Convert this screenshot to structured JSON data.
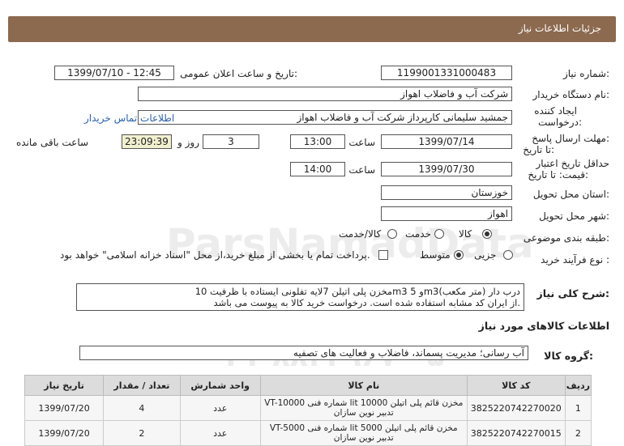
{
  "header": {
    "title": "جزئیات اطلاعات نیاز"
  },
  "fields": {
    "need_number_label": "شماره نیاز:",
    "need_number": "1199001331000483",
    "announce_label": "تاریخ و ساعت اعلان عمومی:",
    "announce_value": "1399/07/10 - 12:45",
    "buyer_label": "نام دستگاه خریدار:",
    "buyer_value": "شرکت آب و فاضلاب اهواز",
    "creator_label_1": "ایجاد کننده",
    "creator_label_2": "درخواست:",
    "creator_value": "جمشید سلیمانی کارپرداز شرکت آب و فاضلاب اهواز",
    "contact_link": "اطلاعات تماس خریدار",
    "deadline_label_1": "مهلت ارسال پاسخ:",
    "deadline_label_2": "تا تاریخ:",
    "deadline_date": "1399/07/14",
    "time_label": "ساعت",
    "deadline_time": "13:00",
    "days_value": "3",
    "days_label": "روز و",
    "remaining_time": "23:09:39",
    "remaining_label": "ساعت باقی مانده",
    "validity_label_1": "حداقل تاریخ اعتبار",
    "validity_label_2": "قیمت: تا تاریخ:",
    "validity_date": "1399/07/30",
    "validity_time": "14:00",
    "province_label": "استان محل تحویل:",
    "province_value": "خوزستان",
    "city_label": "شهر محل تحویل:",
    "city_value": "اهواز",
    "category_label": "طبقه بندی موضوعی:",
    "category_options": [
      "کالا",
      "خدمت",
      "کالا/خدمت"
    ],
    "category_selected": "کالا",
    "purchase_label": "نوع فرآیند خرید :",
    "purchase_options": [
      "جزیی",
      "متوسط"
    ],
    "purchase_selected": "متوسط",
    "payment_note": "پرداخت تمام یا بخشی از مبلغ خرید،از محل \"اسناد خزانه اسلامی\" خواهد بود."
  },
  "description": {
    "label": "شرح کلی نیاز:",
    "lines": [
      "مخزن پلی اتیلن 7لایه تفلونی ایستاده با ظرفیت 10m3 و 5m3(متر مکعب) درب دار",
      "از ایران کد مشابه استفاده شده است. درخواست خرید کالا به پیوست می باشد."
    ]
  },
  "goods": {
    "section_title": "اطلاعات کالاهای مورد نیاز",
    "group_label": "گروه کالا:",
    "group_value": "آب رسانی؛ مدیریت پسماند، فاضلاب و فعالیت های تصفیه",
    "columns": [
      "ردیف",
      "کد کالا",
      "نام کالا",
      "واحد شمارش",
      "تعداد / مقدار",
      "تاریخ نیاز"
    ],
    "rows": [
      [
        "1",
        "3825220742270020",
        "مخزن قائم پلی اتیلن 10000 lit شماره فنی VT-10000 تدبیر نوین سازان",
        "عدد",
        "4",
        "1399/07/20"
      ],
      [
        "2",
        "3825220742270015",
        "مخزن قائم پلی اتیلن 5000 lit شماره فنی VT-5000 تدبیر نوین سازان",
        "عدد",
        "2",
        "1399/07/20"
      ]
    ]
  },
  "watermark": {
    "text": "ParsNamadData",
    "phone": "۰۲۱-۸۸۳۴۹۶۷۰-۵"
  }
}
